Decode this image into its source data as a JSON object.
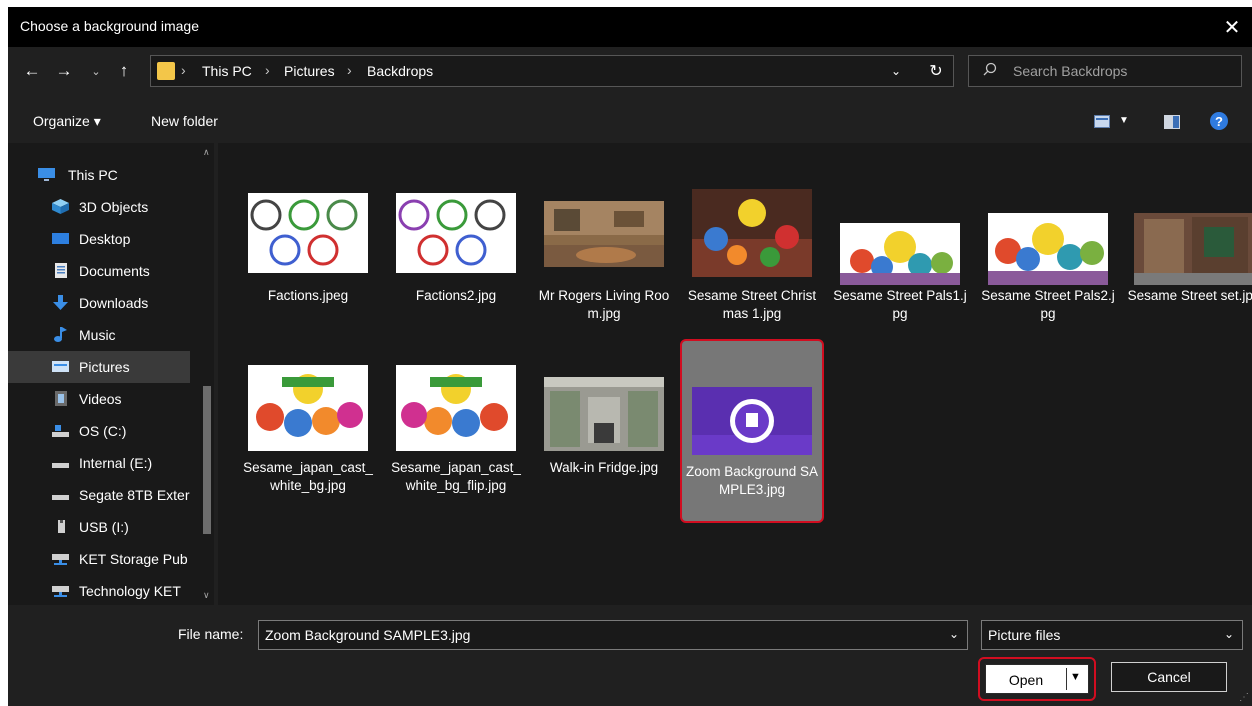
{
  "dialog": {
    "title": "Choose a background image",
    "close_label": "✕"
  },
  "nav": {
    "back": "←",
    "forward": "→",
    "recent": "⌄",
    "up": "↑",
    "breadcrumbs": [
      "This PC",
      "Pictures",
      "Backdrops"
    ],
    "separator": "›",
    "refresh": "↻"
  },
  "search": {
    "placeholder": "Search Backdrops"
  },
  "toolbar": {
    "organize": "Organize ▾",
    "new_folder": "New folder",
    "help": "?"
  },
  "sidebar": {
    "items": [
      {
        "label": "This PC",
        "icon": "monitor-icon"
      },
      {
        "label": "3D Objects",
        "icon": "cube-icon"
      },
      {
        "label": "Desktop",
        "icon": "desktop-icon"
      },
      {
        "label": "Documents",
        "icon": "document-icon"
      },
      {
        "label": "Downloads",
        "icon": "download-icon"
      },
      {
        "label": "Music",
        "icon": "music-icon"
      },
      {
        "label": "Pictures",
        "icon": "pictures-icon",
        "selected": true
      },
      {
        "label": "Videos",
        "icon": "video-icon"
      },
      {
        "label": "OS (C:)",
        "icon": "drive-icon"
      },
      {
        "label": "Internal (E:)",
        "icon": "drive-icon"
      },
      {
        "label": "Segate 8TB Exter",
        "icon": "drive-icon"
      },
      {
        "label": "USB (I:)",
        "icon": "usb-icon"
      },
      {
        "label": "KET Storage Pub",
        "icon": "network-drive-icon"
      },
      {
        "label": "Technology KET",
        "icon": "network-drive-icon"
      }
    ]
  },
  "files": [
    {
      "name": "Factions.jpeg"
    },
    {
      "name": "Factions2.jpg"
    },
    {
      "name": "Mr Rogers Living Room.jpg"
    },
    {
      "name": "Sesame Street Christmas 1.jpg"
    },
    {
      "name": "Sesame Street Pals1.jpg"
    },
    {
      "name": "Sesame Street Pals2.jpg"
    },
    {
      "name": "Sesame Street set.jpg"
    },
    {
      "name": "Sesame_japan_cast_white_bg.jpg"
    },
    {
      "name": "Sesame_japan_cast_white_bg_flip.jpg"
    },
    {
      "name": "Walk-in Fridge.jpg"
    },
    {
      "name": "Zoom Background SAMPLE3.jpg",
      "selected": true
    }
  ],
  "footer": {
    "file_name_label": "File name:",
    "file_name_value": "Zoom Background SAMPLE3.jpg",
    "file_type": "Picture files",
    "open_label": "Open",
    "cancel_label": "Cancel"
  },
  "colors": {
    "background": "#202020",
    "pane": "#191919",
    "highlight_outline": "#d10d20",
    "selected_item": "#777777"
  }
}
